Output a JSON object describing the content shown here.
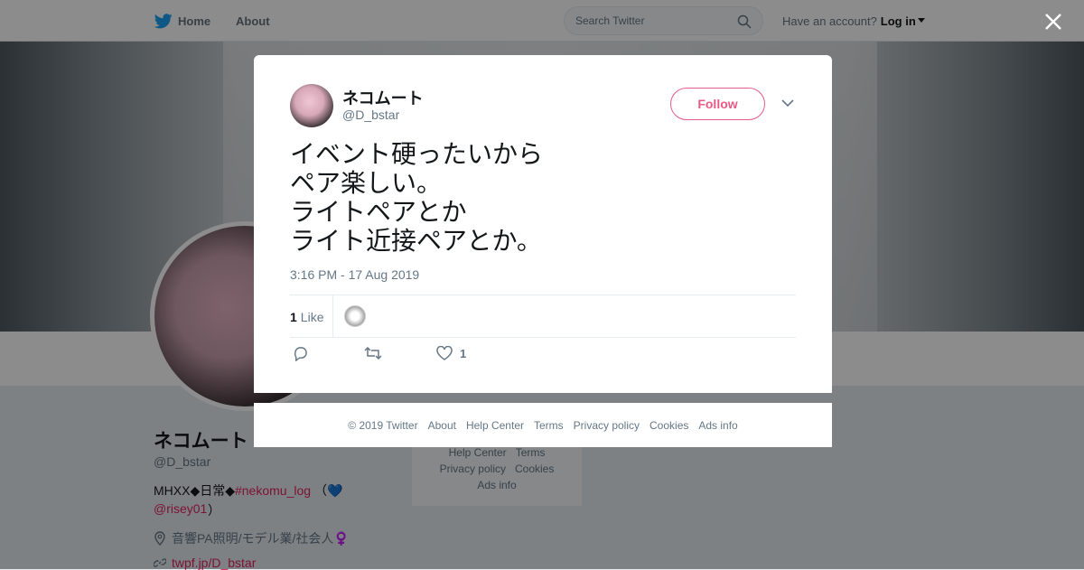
{
  "topbar": {
    "home_label": "Home",
    "about_label": "About",
    "search_placeholder": "Search Twitter",
    "have_account": "Have an account?",
    "login_label": "Log in"
  },
  "profile": {
    "name": "ネコムート",
    "handle": "@D_bstar",
    "bio_prefix": "MHXX◆日常◆",
    "bio_hashtag": "#nekomu_log",
    "bio_paren_open": "（",
    "bio_heart": "💙",
    "bio_mention": "@risey01",
    "bio_paren_close": "）",
    "location": "音響PA照明/モデル業/社会人♀️",
    "website": "twpf.jp/D_bstar"
  },
  "side_box": {
    "line1_a": "Help Center",
    "line1_b": "Terms",
    "line2_a": "Privacy policy",
    "line2_b": "Cookies",
    "line3": "Ads info"
  },
  "tweet": {
    "name": "ネコムート",
    "handle": "@D_bstar",
    "follow_label": "Follow",
    "text": "イベント硬ったいから\nペア楽しい。\nライトペアとか\nライト近接ペアとか。",
    "timestamp": "3:16 PM - 17 Aug 2019",
    "like_count": "1",
    "like_label": "Like",
    "action_like_count": "1"
  },
  "footer": {
    "copyright": "© 2019 Twitter",
    "about": "About",
    "help": "Help Center",
    "terms": "Terms",
    "privacy": "Privacy policy",
    "cookies": "Cookies",
    "ads": "Ads info"
  },
  "colors": {
    "accent": "#e0245e",
    "twitter_blue": "#1da1f2"
  }
}
